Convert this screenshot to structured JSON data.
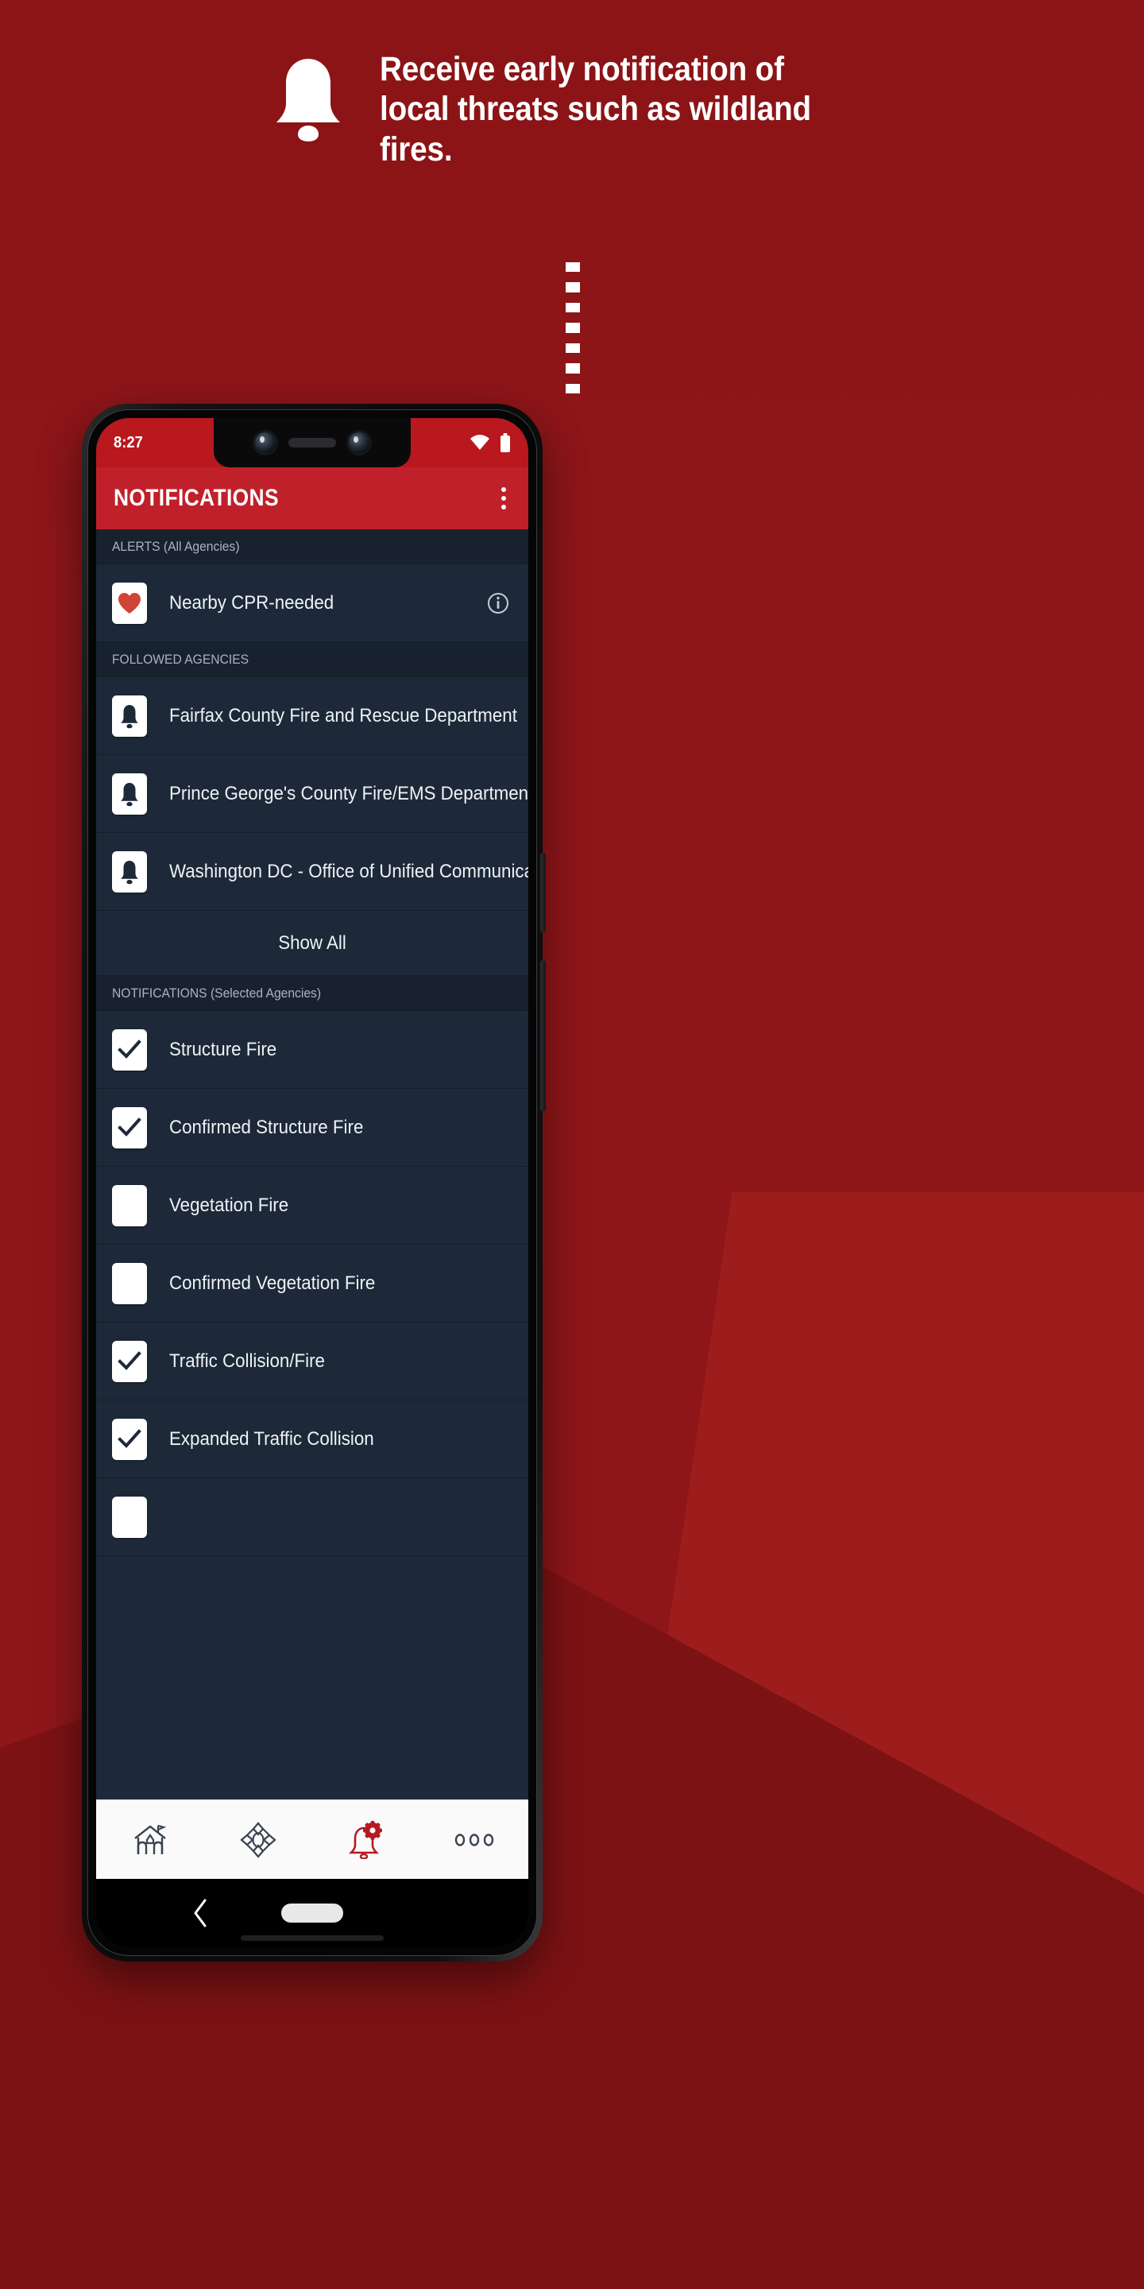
{
  "promo": {
    "headline": "Receive early notification of local threats such as wildland fires.",
    "bell_icon": "bell-icon",
    "connector": "dotted-line-connector",
    "bg_color": "#8e1619",
    "accent_color": "#c0202a"
  },
  "phone": {
    "status_bar": {
      "time": "8:27",
      "icons": [
        "wifi-icon",
        "battery-icon"
      ],
      "bg_color": "#b9181f"
    },
    "app_bar": {
      "title": "NOTIFICATIONS",
      "overflow_menu": "overflow-menu-icon",
      "bg_color": "#c0202a"
    },
    "sections": [
      {
        "id": "alerts",
        "header": "ALERTS (All Agencies)",
        "rows": [
          {
            "icon": "heart-icon",
            "label": "Nearby CPR-needed",
            "trailing": "info-icon"
          }
        ]
      },
      {
        "id": "followed-agencies",
        "header": "FOLLOWED AGENCIES",
        "rows": [
          {
            "icon": "bell-icon",
            "label": "Fairfax County Fire and Rescue Department"
          },
          {
            "icon": "bell-icon",
            "label": "Prince George's County Fire/EMS Department"
          },
          {
            "icon": "bell-icon",
            "label": "Washington DC - Office of Unified Communicati…"
          }
        ],
        "show_all_label": "Show All"
      },
      {
        "id": "notifications",
        "header": "NOTIFICATIONS (Selected Agencies)",
        "rows": [
          {
            "icon": "checkbox-checked",
            "label": "Structure Fire",
            "checked": true
          },
          {
            "icon": "checkbox-checked",
            "label": "Confirmed Structure Fire",
            "checked": true
          },
          {
            "icon": "checkbox-unchecked",
            "label": "Vegetation Fire",
            "checked": false
          },
          {
            "icon": "checkbox-unchecked",
            "label": "Confirmed Vegetation Fire",
            "checked": false
          },
          {
            "icon": "checkbox-checked",
            "label": "Traffic Collision/Fire",
            "checked": true
          },
          {
            "icon": "checkbox-checked",
            "label": "Expanded Traffic Collision",
            "checked": true
          }
        ]
      }
    ],
    "bottom_nav": {
      "items": [
        {
          "icon": "firehouse-icon",
          "active": false
        },
        {
          "icon": "fire-maltese-cross-icon",
          "active": false
        },
        {
          "icon": "bell-gear-icon",
          "active": true
        },
        {
          "icon": "more-dots-icon",
          "active": false
        }
      ],
      "active_color": "#b51a22",
      "inactive_color": "#3a4450",
      "bg_color": "#fafafa"
    },
    "android_nav": {
      "back": "back-chevron-icon",
      "home": "home-pill-handle"
    }
  }
}
